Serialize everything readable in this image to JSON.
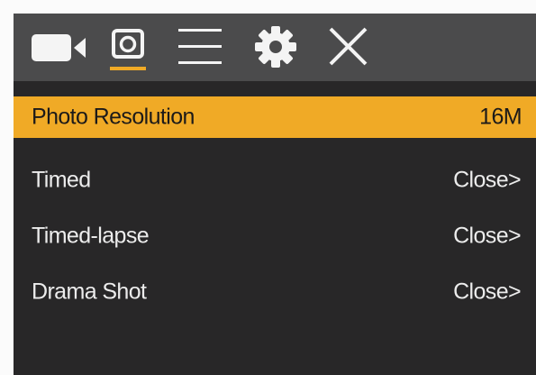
{
  "toolbar": {
    "icons": [
      "video-camera-icon",
      "photo-camera-icon",
      "menu-list-icon",
      "settings-gear-icon",
      "close-icon"
    ],
    "active": "photo-camera-icon",
    "accent": "#f0aa26"
  },
  "menu": {
    "items": [
      {
        "label": "Photo Resolution",
        "value": "16M"
      },
      {
        "label": "Timed",
        "value": "Close>"
      },
      {
        "label": "Timed-lapse",
        "value": "Close>"
      },
      {
        "label": "Drama Shot",
        "value": "Close>"
      }
    ],
    "selected_index": 0
  },
  "colors": {
    "background": "#282728",
    "toolbar": "#4b4b4c",
    "highlight": "#f0aa26",
    "text": "#ececec"
  }
}
